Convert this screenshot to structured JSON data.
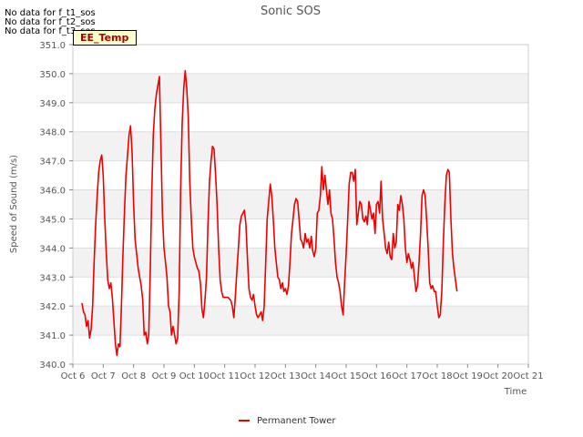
{
  "notices": [
    "No data for f_t1_sos",
    "No data for f_t2_sos",
    "No data for f_t3_sos"
  ],
  "tag_label": "EE_Temp",
  "colors": {
    "series": "#ee0000",
    "band": "#f2f2f2",
    "grid": "#dddddd",
    "axis": "#cccccc",
    "text": "#555555",
    "tag_bg": "#ffffcc",
    "tag_text": "#aa0000"
  },
  "chart_data": {
    "type": "line",
    "title": "Sonic SOS",
    "xlabel": "Time",
    "ylabel": "Speed of Sound (m/s)",
    "xlim": [
      6,
      21
    ],
    "ylim": [
      340.0,
      351.0
    ],
    "x_ticks": [
      {
        "v": 6,
        "label": "Oct 6"
      },
      {
        "v": 7,
        "label": "Oct 7"
      },
      {
        "v": 8,
        "label": "Oct 8"
      },
      {
        "v": 9,
        "label": "Oct 9"
      },
      {
        "v": 10,
        "label": "Oct 10"
      },
      {
        "v": 11,
        "label": "Oct 11"
      },
      {
        "v": 12,
        "label": "Oct 12"
      },
      {
        "v": 13,
        "label": "Oct 13"
      },
      {
        "v": 14,
        "label": "Oct 14"
      },
      {
        "v": 15,
        "label": "Oct 15"
      },
      {
        "v": 16,
        "label": "Oct 16"
      },
      {
        "v": 17,
        "label": "Oct 17"
      },
      {
        "v": 18,
        "label": "Oct 18"
      },
      {
        "v": 19,
        "label": "Oct 19"
      },
      {
        "v": 20,
        "label": "Oct 20"
      },
      {
        "v": 21,
        "label": "Oct 21"
      }
    ],
    "y_ticks": [
      {
        "v": 340,
        "label": "340.0"
      },
      {
        "v": 341,
        "label": "341.0"
      },
      {
        "v": 342,
        "label": "342.0"
      },
      {
        "v": 343,
        "label": "343.0"
      },
      {
        "v": 344,
        "label": "344.0"
      },
      {
        "v": 345,
        "label": "345.0"
      },
      {
        "v": 346,
        "label": "346.0"
      },
      {
        "v": 347,
        "label": "347.0"
      },
      {
        "v": 348,
        "label": "348.0"
      },
      {
        "v": 349,
        "label": "349.0"
      },
      {
        "v": 350,
        "label": "350.0"
      },
      {
        "v": 351,
        "label": "351.0"
      }
    ],
    "grid": true,
    "legend_position": "bottom-center",
    "series": [
      {
        "name": "Permanent Tower",
        "color": "#ee0000",
        "points": [
          [
            6.3,
            342.1
          ],
          [
            6.35,
            341.8
          ],
          [
            6.4,
            341.7
          ],
          [
            6.45,
            341.3
          ],
          [
            6.5,
            341.5
          ],
          [
            6.55,
            340.9
          ],
          [
            6.6,
            341.2
          ],
          [
            6.65,
            342.0
          ],
          [
            6.7,
            343.5
          ],
          [
            6.75,
            344.8
          ],
          [
            6.8,
            345.8
          ],
          [
            6.85,
            346.6
          ],
          [
            6.9,
            347.0
          ],
          [
            6.95,
            347.2
          ],
          [
            7.0,
            346.5
          ],
          [
            7.05,
            345.0
          ],
          [
            7.1,
            343.8
          ],
          [
            7.15,
            342.9
          ],
          [
            7.2,
            342.6
          ],
          [
            7.25,
            342.8
          ],
          [
            7.3,
            342.3
          ],
          [
            7.35,
            341.5
          ],
          [
            7.4,
            340.7
          ],
          [
            7.45,
            340.3
          ],
          [
            7.5,
            340.7
          ],
          [
            7.55,
            340.6
          ],
          [
            7.6,
            342.0
          ],
          [
            7.65,
            343.8
          ],
          [
            7.7,
            345.3
          ],
          [
            7.75,
            346.5
          ],
          [
            7.8,
            347.2
          ],
          [
            7.85,
            347.9
          ],
          [
            7.9,
            348.2
          ],
          [
            7.95,
            347.3
          ],
          [
            8.0,
            345.5
          ],
          [
            8.05,
            344.3
          ],
          [
            8.1,
            343.8
          ],
          [
            8.15,
            343.3
          ],
          [
            8.2,
            343.0
          ],
          [
            8.25,
            342.7
          ],
          [
            8.3,
            342.2
          ],
          [
            8.35,
            341.0
          ],
          [
            8.4,
            341.1
          ],
          [
            8.45,
            340.7
          ],
          [
            8.5,
            341.0
          ],
          [
            8.55,
            343.3
          ],
          [
            8.6,
            346.0
          ],
          [
            8.65,
            347.9
          ],
          [
            8.7,
            348.8
          ],
          [
            8.75,
            349.3
          ],
          [
            8.8,
            349.6
          ],
          [
            8.85,
            349.9
          ],
          [
            8.9,
            347.5
          ],
          [
            8.95,
            345.2
          ],
          [
            9.0,
            344.0
          ],
          [
            9.05,
            343.5
          ],
          [
            9.1,
            343.0
          ],
          [
            9.15,
            342.0
          ],
          [
            9.2,
            341.8
          ],
          [
            9.25,
            341.0
          ],
          [
            9.3,
            341.3
          ],
          [
            9.35,
            341.0
          ],
          [
            9.4,
            340.7
          ],
          [
            9.45,
            340.9
          ],
          [
            9.5,
            342.5
          ],
          [
            9.55,
            346.0
          ],
          [
            9.6,
            348.3
          ],
          [
            9.65,
            349.5
          ],
          [
            9.7,
            350.1
          ],
          [
            9.75,
            349.5
          ],
          [
            9.8,
            348.5
          ],
          [
            9.85,
            346.3
          ],
          [
            9.9,
            345.0
          ],
          [
            9.95,
            344.0
          ],
          [
            10.0,
            343.7
          ],
          [
            10.05,
            343.5
          ],
          [
            10.1,
            343.3
          ],
          [
            10.15,
            343.2
          ],
          [
            10.2,
            342.8
          ],
          [
            10.25,
            341.9
          ],
          [
            10.3,
            341.6
          ],
          [
            10.35,
            342.2
          ],
          [
            10.4,
            343.0
          ],
          [
            10.45,
            344.8
          ],
          [
            10.5,
            346.3
          ],
          [
            10.55,
            347.0
          ],
          [
            10.6,
            347.5
          ],
          [
            10.65,
            347.4
          ],
          [
            10.7,
            346.5
          ],
          [
            10.75,
            345.5
          ],
          [
            10.8,
            344.0
          ],
          [
            10.85,
            342.9
          ],
          [
            10.9,
            342.5
          ],
          [
            10.95,
            342.3
          ],
          [
            11.0,
            342.3
          ],
          [
            11.1,
            342.3
          ],
          [
            11.2,
            342.2
          ],
          [
            11.25,
            342.0
          ],
          [
            11.3,
            341.6
          ],
          [
            11.35,
            342.3
          ],
          [
            11.4,
            343.2
          ],
          [
            11.45,
            344.0
          ],
          [
            11.5,
            344.8
          ],
          [
            11.55,
            345.1
          ],
          [
            11.6,
            345.2
          ],
          [
            11.65,
            345.3
          ],
          [
            11.7,
            344.8
          ],
          [
            11.75,
            343.6
          ],
          [
            11.8,
            342.6
          ],
          [
            11.85,
            342.3
          ],
          [
            11.9,
            342.2
          ],
          [
            11.95,
            342.4
          ],
          [
            12.0,
            342.0
          ],
          [
            12.05,
            341.7
          ],
          [
            12.1,
            341.6
          ],
          [
            12.15,
            341.7
          ],
          [
            12.2,
            341.8
          ],
          [
            12.25,
            341.5
          ],
          [
            12.3,
            342.0
          ],
          [
            12.35,
            343.5
          ],
          [
            12.4,
            345.0
          ],
          [
            12.45,
            345.6
          ],
          [
            12.5,
            346.2
          ],
          [
            12.55,
            345.8
          ],
          [
            12.6,
            345.0
          ],
          [
            12.65,
            344.0
          ],
          [
            12.7,
            343.5
          ],
          [
            12.75,
            343.0
          ],
          [
            12.8,
            342.9
          ],
          [
            12.85,
            342.6
          ],
          [
            12.9,
            342.8
          ],
          [
            12.95,
            342.5
          ],
          [
            13.0,
            342.6
          ],
          [
            13.05,
            342.4
          ],
          [
            13.1,
            342.7
          ],
          [
            13.15,
            343.5
          ],
          [
            13.2,
            344.5
          ],
          [
            13.25,
            345.0
          ],
          [
            13.3,
            345.5
          ],
          [
            13.35,
            345.7
          ],
          [
            13.4,
            345.6
          ],
          [
            13.45,
            345.0
          ],
          [
            13.5,
            344.3
          ],
          [
            13.55,
            344.2
          ],
          [
            13.6,
            344.0
          ],
          [
            13.65,
            344.5
          ],
          [
            13.7,
            344.2
          ],
          [
            13.75,
            344.3
          ],
          [
            13.8,
            344.0
          ],
          [
            13.85,
            344.4
          ],
          [
            13.9,
            343.9
          ],
          [
            13.95,
            343.7
          ],
          [
            14.0,
            344.0
          ],
          [
            14.05,
            345.2
          ],
          [
            14.1,
            345.3
          ],
          [
            14.15,
            345.8
          ],
          [
            14.2,
            346.8
          ],
          [
            14.25,
            346.0
          ],
          [
            14.3,
            346.5
          ],
          [
            14.35,
            346.0
          ],
          [
            14.4,
            345.5
          ],
          [
            14.45,
            346.0
          ],
          [
            14.5,
            345.2
          ],
          [
            14.55,
            345.0
          ],
          [
            14.6,
            344.3
          ],
          [
            14.65,
            343.5
          ],
          [
            14.7,
            343.0
          ],
          [
            14.75,
            342.8
          ],
          [
            14.8,
            342.5
          ],
          [
            14.85,
            342.0
          ],
          [
            14.9,
            341.7
          ],
          [
            14.95,
            342.8
          ],
          [
            15.0,
            343.8
          ],
          [
            15.05,
            345.0
          ],
          [
            15.1,
            346.2
          ],
          [
            15.15,
            346.6
          ],
          [
            15.2,
            346.6
          ],
          [
            15.25,
            346.3
          ],
          [
            15.3,
            346.7
          ],
          [
            15.35,
            344.8
          ],
          [
            15.4,
            345.2
          ],
          [
            15.45,
            345.6
          ],
          [
            15.5,
            345.5
          ],
          [
            15.55,
            345.0
          ],
          [
            15.6,
            344.9
          ],
          [
            15.65,
            345.1
          ],
          [
            15.7,
            344.8
          ],
          [
            15.75,
            345.6
          ],
          [
            15.8,
            345.3
          ],
          [
            15.85,
            345.0
          ],
          [
            15.9,
            345.2
          ],
          [
            15.95,
            344.5
          ],
          [
            16.0,
            345.5
          ],
          [
            16.05,
            345.6
          ],
          [
            16.1,
            345.2
          ],
          [
            16.15,
            346.3
          ],
          [
            16.2,
            345.0
          ],
          [
            16.25,
            344.5
          ],
          [
            16.3,
            344.0
          ],
          [
            16.35,
            343.8
          ],
          [
            16.4,
            344.2
          ],
          [
            16.45,
            343.7
          ],
          [
            16.5,
            343.6
          ],
          [
            16.55,
            344.5
          ],
          [
            16.6,
            344.0
          ],
          [
            16.65,
            344.2
          ],
          [
            16.7,
            345.5
          ],
          [
            16.75,
            345.3
          ],
          [
            16.8,
            345.8
          ],
          [
            16.85,
            345.5
          ],
          [
            16.9,
            345.0
          ],
          [
            16.95,
            344.0
          ],
          [
            17.0,
            343.5
          ],
          [
            17.05,
            343.8
          ],
          [
            17.1,
            343.6
          ],
          [
            17.15,
            343.3
          ],
          [
            17.2,
            343.5
          ],
          [
            17.25,
            343.0
          ],
          [
            17.3,
            342.5
          ],
          [
            17.35,
            342.7
          ],
          [
            17.4,
            343.5
          ],
          [
            17.45,
            344.5
          ],
          [
            17.5,
            345.8
          ],
          [
            17.55,
            346.0
          ],
          [
            17.6,
            345.8
          ],
          [
            17.65,
            345.0
          ],
          [
            17.7,
            344.0
          ],
          [
            17.75,
            342.8
          ],
          [
            17.8,
            342.6
          ],
          [
            17.85,
            342.7
          ],
          [
            17.9,
            342.5
          ],
          [
            17.95,
            342.5
          ],
          [
            18.0,
            342.0
          ],
          [
            18.05,
            341.6
          ],
          [
            18.1,
            341.7
          ],
          [
            18.15,
            342.5
          ],
          [
            18.2,
            344.2
          ],
          [
            18.25,
            345.5
          ],
          [
            18.3,
            346.5
          ],
          [
            18.35,
            346.7
          ],
          [
            18.4,
            346.6
          ],
          [
            18.45,
            345.0
          ],
          [
            18.5,
            343.8
          ],
          [
            18.55,
            343.3
          ],
          [
            18.6,
            342.9
          ],
          [
            18.65,
            342.5
          ]
        ]
      }
    ]
  }
}
